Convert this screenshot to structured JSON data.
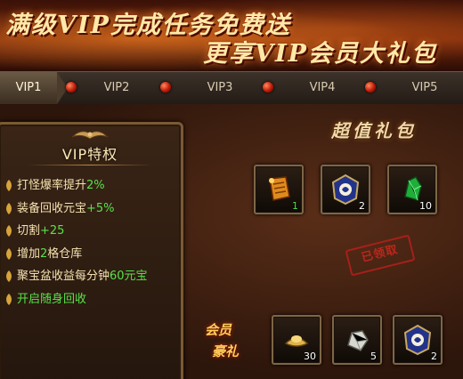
{
  "banner": {
    "line1": "满级VIP完成任务免费送",
    "line2": "更享VIP会员大礼包"
  },
  "tabs": [
    {
      "label": "VIP1",
      "active": true
    },
    {
      "label": "VIP2",
      "active": false
    },
    {
      "label": "VIP3",
      "active": false
    },
    {
      "label": "VIP4",
      "active": false
    },
    {
      "label": "VIP5",
      "active": false
    }
  ],
  "privileges": {
    "title": "VIP特权",
    "items": [
      {
        "text": "打怪爆率提升",
        "value": "2%"
      },
      {
        "text": "装备回收元宝",
        "value": "+5%"
      },
      {
        "text": "切割",
        "value": "+25"
      },
      {
        "text": "增加",
        "value": "2",
        "suffix": "格仓库"
      },
      {
        "text": "聚宝盆收益每分钟",
        "value": "60元宝"
      },
      {
        "text": "开启随身回收",
        "value": ""
      }
    ]
  },
  "super_pack": {
    "title": "超值礼包",
    "items": [
      {
        "icon": "scroll-icon",
        "qty": "1"
      },
      {
        "icon": "blue-badge-icon",
        "qty": "2"
      },
      {
        "icon": "green-gem-icon",
        "qty": "10"
      }
    ],
    "status_stamp": "已领取"
  },
  "member_pack": {
    "label_top": "会员",
    "label_bottom": "豪礼",
    "items": [
      {
        "icon": "gold-ingot-icon",
        "qty": "30"
      },
      {
        "icon": "silver-ore-icon",
        "qty": "5"
      },
      {
        "icon": "blue-badge-icon",
        "qty": "2"
      }
    ]
  },
  "colors": {
    "highlight_green": "#58e24a",
    "gold_text": "#fce9b8",
    "frame": "#7d6648"
  }
}
